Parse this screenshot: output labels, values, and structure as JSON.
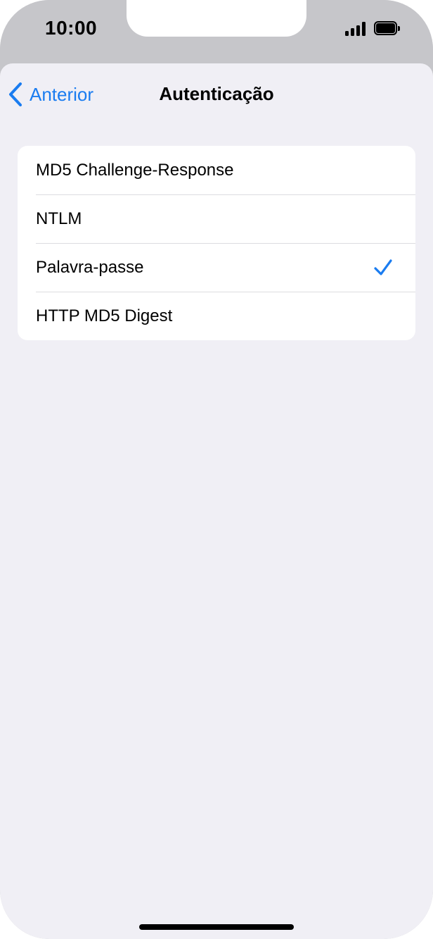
{
  "status_bar": {
    "time": "10:00",
    "signal_icon": "cellular-signal-icon",
    "battery_icon": "battery-full-icon"
  },
  "nav": {
    "back_label": "Anterior",
    "back_icon": "chevron-left-icon",
    "title": "Autenticação"
  },
  "options": [
    {
      "label": "MD5 Challenge-Response",
      "selected": false
    },
    {
      "label": "NTLM",
      "selected": false
    },
    {
      "label": "Palavra-passe",
      "selected": true
    },
    {
      "label": "HTTP MD5 Digest",
      "selected": false
    }
  ],
  "colors": {
    "accent": "#1a7cf0",
    "background": "#f0eff5",
    "status_bar_bg": "#c6c6ca"
  },
  "check_icon": "checkmark-icon"
}
